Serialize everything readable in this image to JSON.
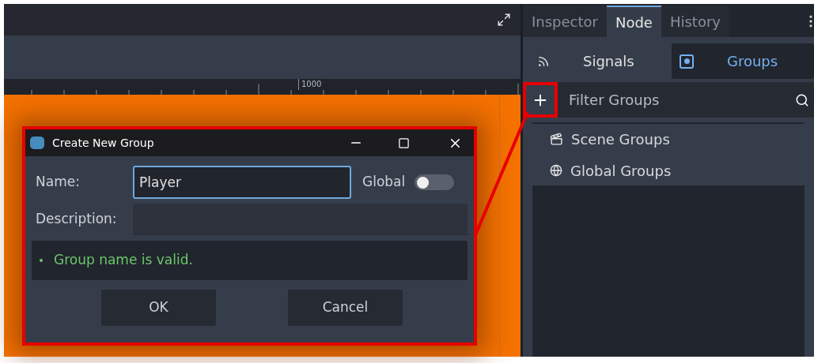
{
  "editor": {
    "ruler_label": "1000"
  },
  "dialog": {
    "title": "Create New Group",
    "name_label": "Name:",
    "name_value": "Player",
    "global_label": "Global",
    "global_on": false,
    "description_label": "Description:",
    "message": "Group name is valid.",
    "buttons": [
      "OK",
      "Cancel"
    ]
  },
  "dock": {
    "tabs": [
      {
        "label": "Inspector",
        "selected": false
      },
      {
        "label": "Node",
        "selected": true
      },
      {
        "label": "History",
        "selected": false
      }
    ],
    "subtabs": [
      {
        "label": "Signals",
        "kind": "signals",
        "selected": false
      },
      {
        "label": "Groups",
        "kind": "groups",
        "selected": true
      }
    ],
    "filter": {
      "placeholder": "Filter Groups"
    },
    "tree": [
      {
        "label": "Scene Groups",
        "kind": "scene"
      },
      {
        "label": "Global Groups",
        "kind": "global"
      }
    ]
  }
}
